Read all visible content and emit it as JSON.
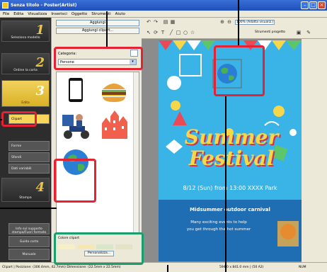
{
  "window": {
    "title": "Senza titolo - Poster(Artist)"
  },
  "menu": [
    "File",
    "Edita",
    "Visualizza",
    "Inserisci",
    "Oggetto",
    "Strumenti",
    "Aiuto"
  ],
  "steps": [
    {
      "num": "1",
      "label": "Seleziona modello"
    },
    {
      "num": "2",
      "label": "Ordine la carta"
    },
    {
      "num": "3",
      "label": "Edita"
    },
    {
      "num": "4",
      "label": "Stampa"
    }
  ],
  "subitems": {
    "cliparts": "Clipart",
    "forme": "Forme",
    "sfondi": "Sfondi",
    "dati": "Dati variabili"
  },
  "lower_buttons": [
    "Info sul supporto stampa/Fuori formato",
    "Guida carta",
    "Manuale"
  ],
  "panel": {
    "add_button1": "Aggiungi",
    "add_button2": "Aggiungi clipart...",
    "category_label": "Categoria:",
    "category_value": "Persone",
    "color_label": "Colore clipart",
    "personalize": "Personalizza..."
  },
  "toolbar": {
    "zoom": "100% (Adatta visualiz.)",
    "tool_label": "Strumenti progetto"
  },
  "poster": {
    "title1": "Summer",
    "title2": "Festival",
    "date": "8/12 (Sun) from 13:00  XXXX Park",
    "tagline": "Midsummer outdoor carnival",
    "line1": "Many exciting events to help",
    "line2": "you get through the hot summer"
  },
  "statusbar": {
    "left": "Clipart  |  Posizione: (306.4mm, 42.7mm) Dimensione: (22.5mm x 22.5mm)",
    "mid": "594.0 x 841.0 mm  |  (50 A2)",
    "right": "NUM"
  },
  "colors": {
    "accent": "#e52231",
    "green": "#1a9e6e",
    "poster_bg": "#3ab4e6",
    "gold": "#f1d25d"
  }
}
